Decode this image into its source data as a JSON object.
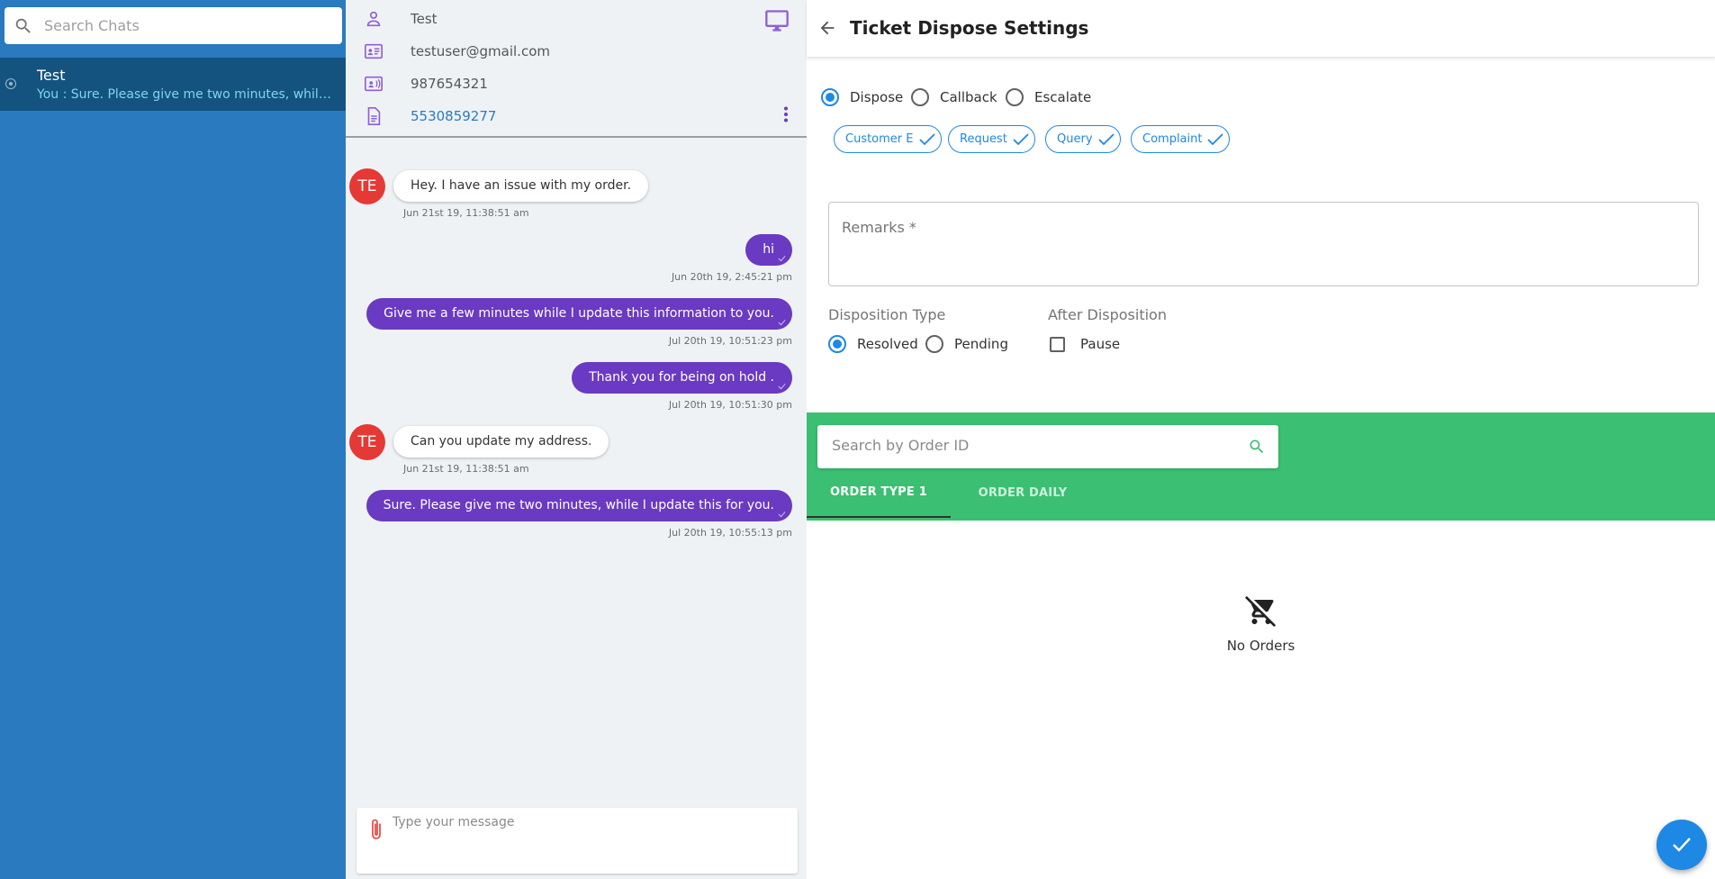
{
  "sidebar": {
    "search_placeholder": "Search Chats",
    "chats": [
      {
        "name": "Test",
        "preview": "You : Sure. Please give me two minutes, while I update this for you."
      }
    ]
  },
  "contact": {
    "name": "Test",
    "email": "testuser@gmail.com",
    "phone": "987654321",
    "ticket": "5530859277"
  },
  "messages": [
    {
      "direction": "in",
      "avatar": "TE",
      "text": "Hey. I have an issue with my order.",
      "time": "Jun 21st 19, 11:38:51 am"
    },
    {
      "direction": "out",
      "text": "hi",
      "time": "Jun 20th 19, 2:45:21 pm"
    },
    {
      "direction": "out",
      "text": "Give me a few minutes while I update this information to you.",
      "time": "Jul 20th 19, 10:51:23 pm"
    },
    {
      "direction": "out",
      "text": "Thank you for being on hold .",
      "time": "Jul 20th 19, 10:51:30 pm"
    },
    {
      "direction": "in",
      "avatar": "TE",
      "text": "Can you update my address.",
      "time": "Jun 21st 19, 11:38:51 am"
    },
    {
      "direction": "out",
      "text": "Sure. Please give me two minutes, while I update this for you.",
      "time": "Jul 20th 19, 10:55:13 pm"
    }
  ],
  "composer": {
    "placeholder": "Type your message"
  },
  "settings": {
    "title": "Ticket Dispose Settings",
    "actions": [
      {
        "label": "Dispose",
        "selected": true
      },
      {
        "label": "Callback",
        "selected": false
      },
      {
        "label": "Escalate",
        "selected": false
      }
    ],
    "tags": [
      "Customer E",
      "Request",
      "Query",
      "Complaint"
    ],
    "remarks_label": "Remarks *",
    "disposition_type": {
      "label": "Disposition Type",
      "options": [
        {
          "label": "Resolved",
          "selected": true
        },
        {
          "label": "Pending",
          "selected": false
        }
      ]
    },
    "after_disposition": {
      "label": "After Disposition",
      "option": {
        "label": "Pause",
        "checked": false
      }
    },
    "orders": {
      "search_placeholder": "Search by Order ID",
      "tabs": [
        {
          "label": "ORDER TYPE 1",
          "active": true
        },
        {
          "label": "ORDER DAILY",
          "active": false
        }
      ],
      "empty_text": "No Orders"
    }
  },
  "colors": {
    "sidebar": "#2a7ac0",
    "sidebar_active": "#145380",
    "outgoing_bubble": "#6a3ac2",
    "avatar": "#e53935",
    "accent": "#1e88e5",
    "orders_band": "#3bbf72"
  }
}
